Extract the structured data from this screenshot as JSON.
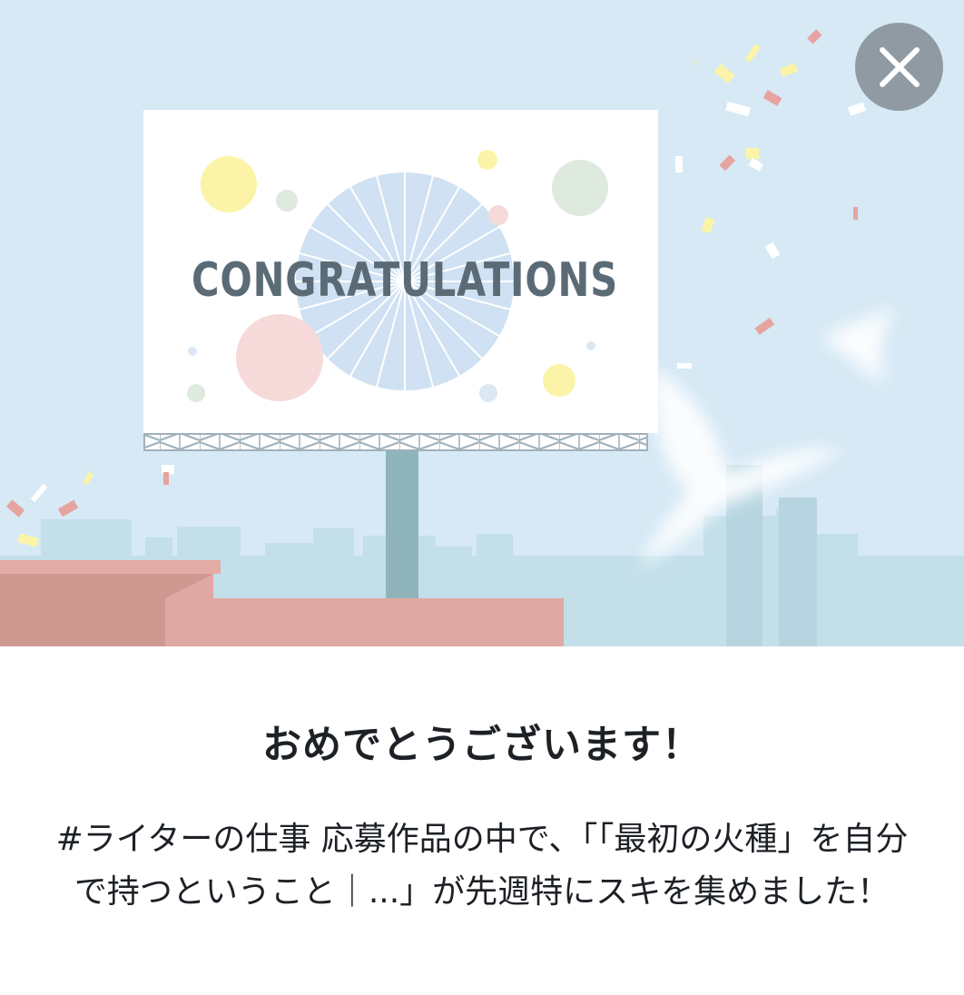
{
  "hero": {
    "billboard_text": "CONGRATULATIONS",
    "colors": {
      "sky": "#d6e9f5",
      "buildings": "#bfdde8",
      "rooftop": "#e0a8a2",
      "pole": "#8fb3b8",
      "billboard_text": "#5b6b76"
    }
  },
  "close_button": {
    "icon": "close-icon"
  },
  "headline": "おめでとうございます！",
  "message": "#ライターの仕事 応募作品の中で、「「最初の火種」を自分で持つということ｜...」が先週特にスキを集めました！"
}
